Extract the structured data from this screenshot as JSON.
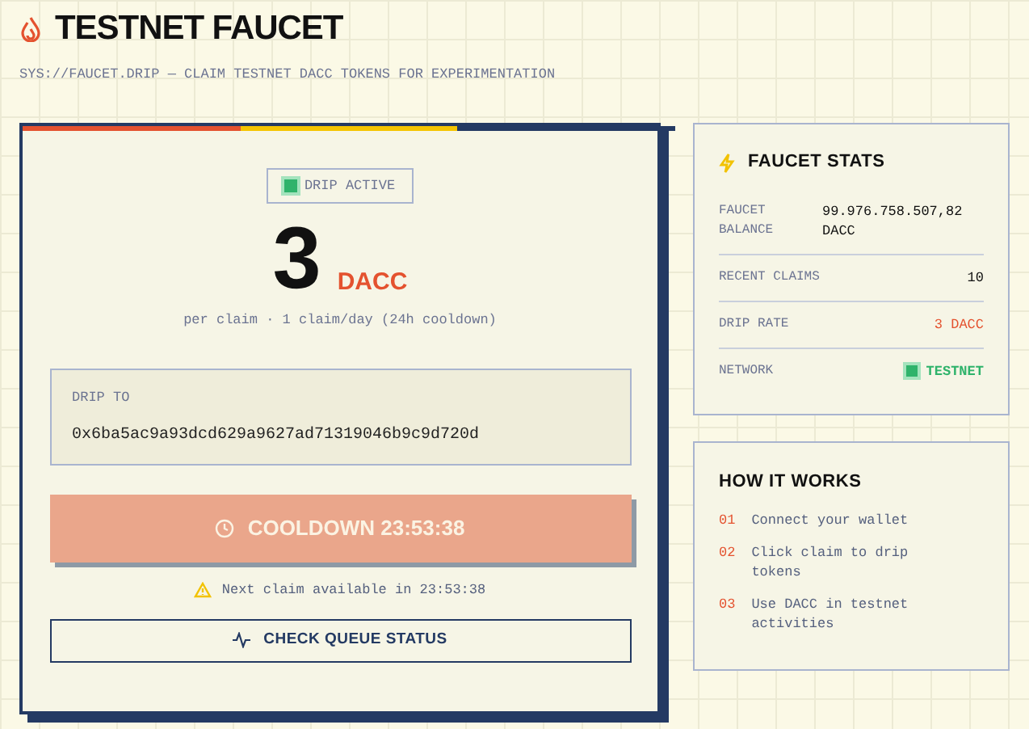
{
  "header": {
    "title": "TESTNET FAUCET",
    "subtitle": "SYS://FAUCET.DRIP — CLAIM TESTNET DACC TOKENS FOR EXPERIMENTATION"
  },
  "claim": {
    "status": {
      "label": "DRIP ACTIVE",
      "on": true
    },
    "amount": "3",
    "unit": "DACC",
    "note": "per claim · 1 claim/day (24h cooldown)",
    "drip_to": {
      "label": "DRIP TO",
      "value": "0x6ba5ac9a93dcd629a9627ad71319046b9c9d720d"
    },
    "claim_button": {
      "label": "COOLDOWN 23:53:38",
      "disabled": true
    },
    "warning": "Next claim available in 23:53:38",
    "queue_button": {
      "label": "CHECK QUEUE STATUS"
    }
  },
  "stats": {
    "title": "FAUCET STATS",
    "rows": [
      {
        "label": "FAUCET BALANCE",
        "value": "99.976.758.507,82 DACC",
        "kind": "plain"
      },
      {
        "label": "RECENT CLAIMS",
        "value": "10",
        "kind": "plain"
      },
      {
        "label": "DRIP RATE",
        "value": "3 DACC",
        "kind": "accent"
      },
      {
        "label": "NETWORK",
        "value": "TESTNET",
        "kind": "status"
      }
    ]
  },
  "how": {
    "title": "HOW IT WORKS",
    "steps": [
      {
        "number": "01",
        "text": "Connect your wallet"
      },
      {
        "number": "02",
        "text": "Click claim to drip tokens"
      },
      {
        "number": "03",
        "text": "Use DACC in testnet activities"
      }
    ]
  }
}
